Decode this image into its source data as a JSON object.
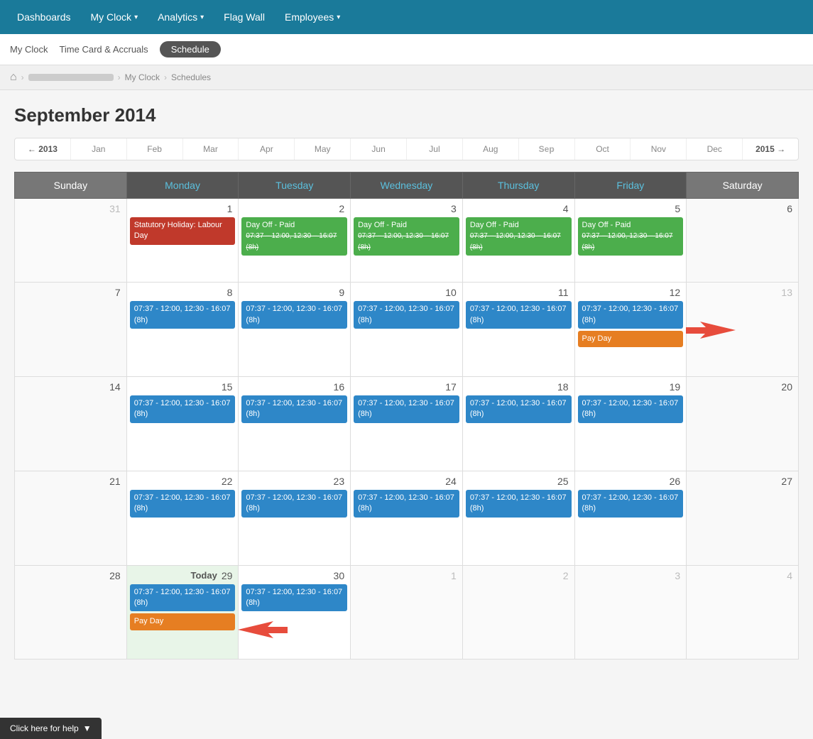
{
  "topNav": {
    "items": [
      {
        "label": "Dashboards",
        "hasArrow": false
      },
      {
        "label": "My Clock",
        "hasArrow": true
      },
      {
        "label": "Analytics",
        "hasArrow": true
      },
      {
        "label": "Flag Wall",
        "hasArrow": false
      },
      {
        "label": "Employees",
        "hasArrow": true
      }
    ]
  },
  "subNav": {
    "items": [
      {
        "label": "My Clock",
        "active": false
      },
      {
        "label": "Time Card & Accruals",
        "active": false
      },
      {
        "label": "Schedule",
        "active": true,
        "pill": true
      }
    ]
  },
  "breadcrumb": {
    "home": "⌂",
    "separator": "›",
    "links": [
      "My Clock",
      "Schedules"
    ]
  },
  "monthTitle": "September 2014",
  "monthNav": {
    "items": [
      {
        "label": "← 2013",
        "type": "arrow"
      },
      {
        "label": "Jan"
      },
      {
        "label": "Feb"
      },
      {
        "label": "Mar"
      },
      {
        "label": "Apr"
      },
      {
        "label": "May"
      },
      {
        "label": "Jun"
      },
      {
        "label": "Jul"
      },
      {
        "label": "Aug"
      },
      {
        "label": "Sep",
        "active": true
      },
      {
        "label": "Oct"
      },
      {
        "label": "Nov"
      },
      {
        "label": "Dec"
      },
      {
        "label": "2015 →",
        "type": "arrow"
      }
    ]
  },
  "calendar": {
    "headers": [
      "Sunday",
      "Monday",
      "Tuesday",
      "Wednesday",
      "Thursday",
      "Friday",
      "Saturday"
    ],
    "rows": [
      {
        "cells": [
          {
            "day": "31",
            "type": "other-month"
          },
          {
            "day": "1",
            "events": [
              {
                "text": "Statutory Holiday: Labour Day",
                "type": "red"
              }
            ]
          },
          {
            "day": "2",
            "events": [
              {
                "text": "Day Off - Paid",
                "time": "07:37 – 12:00, 12:30 – 16:07 (8h)",
                "type": "green"
              }
            ]
          },
          {
            "day": "3",
            "events": [
              {
                "text": "Day Off - Paid",
                "time": "07:37 – 12:00, 12:30 – 16:07 (8h)",
                "type": "green"
              }
            ]
          },
          {
            "day": "4",
            "events": [
              {
                "text": "Day Off - Paid",
                "time": "07:37 – 12:00, 12:30 – 16:07 (8h)",
                "type": "green"
              }
            ]
          },
          {
            "day": "5",
            "events": [
              {
                "text": "Day Off - Paid",
                "time": "07:37 – 12:00, 12:30 – 16:07 (8h)",
                "type": "green"
              }
            ]
          },
          {
            "day": "6",
            "type": "saturday"
          }
        ]
      },
      {
        "cells": [
          {
            "day": "7"
          },
          {
            "day": "8",
            "events": [
              {
                "text": "07:37 - 12:00, 12:30 - 16:07 (8h)",
                "type": "blue"
              }
            ]
          },
          {
            "day": "9",
            "events": [
              {
                "text": "07:37 - 12:00, 12:30 - 16:07 (8h)",
                "type": "blue"
              }
            ]
          },
          {
            "day": "10",
            "events": [
              {
                "text": "07:37 - 12:00, 12:30 - 16:07 (8h)",
                "type": "blue"
              }
            ]
          },
          {
            "day": "11",
            "events": [
              {
                "text": "07:37 - 12:00, 12:30 - 16:07 (8h)",
                "type": "blue"
              }
            ]
          },
          {
            "day": "12",
            "events": [
              {
                "text": "07:37 - 12:00, 12:30 - 16:07 (8h)",
                "type": "blue"
              },
              {
                "text": "Pay Day",
                "type": "orange"
              }
            ],
            "hasArrow": true
          },
          {
            "day": "13",
            "type": "saturday other-month"
          }
        ]
      },
      {
        "cells": [
          {
            "day": "14"
          },
          {
            "day": "15",
            "events": [
              {
                "text": "07:37 - 12:00, 12:30 - 16:07 (8h)",
                "type": "blue"
              }
            ]
          },
          {
            "day": "16",
            "events": [
              {
                "text": "07:37 - 12:00, 12:30 - 16:07 (8h)",
                "type": "blue"
              }
            ]
          },
          {
            "day": "17",
            "events": [
              {
                "text": "07:37 - 12:00, 12:30 - 16:07 (8h)",
                "type": "blue"
              }
            ]
          },
          {
            "day": "18",
            "events": [
              {
                "text": "07:37 - 12:00, 12:30 - 16:07 (8h)",
                "type": "blue"
              }
            ]
          },
          {
            "day": "19",
            "events": [
              {
                "text": "07:37 - 12:00, 12:30 - 16:07 (8h)",
                "type": "blue"
              }
            ]
          },
          {
            "day": "20",
            "type": "saturday"
          }
        ]
      },
      {
        "cells": [
          {
            "day": "21"
          },
          {
            "day": "22",
            "events": [
              {
                "text": "07:37 - 12:00, 12:30 - 16:07 (8h)",
                "type": "blue"
              }
            ]
          },
          {
            "day": "23",
            "events": [
              {
                "text": "07:37 - 12:00, 12:30 - 16:07 (8h)",
                "type": "blue"
              }
            ]
          },
          {
            "day": "24",
            "events": [
              {
                "text": "07:37 - 12:00, 12:30 - 16:07 (8h)",
                "type": "blue"
              }
            ]
          },
          {
            "day": "25",
            "events": [
              {
                "text": "07:37 - 12:00, 12:30 - 16:07 (8h)",
                "type": "blue"
              }
            ]
          },
          {
            "day": "26",
            "events": [
              {
                "text": "07:37 - 12:00, 12:30 - 16:07 (8h)",
                "type": "blue"
              }
            ]
          },
          {
            "day": "27",
            "type": "saturday"
          }
        ]
      },
      {
        "cells": [
          {
            "day": "28"
          },
          {
            "day": "29",
            "isToday": true,
            "events": [
              {
                "text": "07:37 - 12:00, 12:30 - 16:07 (8h)",
                "type": "blue"
              },
              {
                "text": "Pay Day",
                "type": "orange"
              }
            ]
          },
          {
            "day": "30",
            "events": [
              {
                "text": "07:37 - 12:00, 12:30 - 16:07 (8h)",
                "type": "blue"
              }
            ]
          },
          {
            "day": "1",
            "type": "other-month"
          },
          {
            "day": "2",
            "type": "other-month"
          },
          {
            "day": "3",
            "type": "other-month"
          },
          {
            "day": "4",
            "type": "other-month saturday"
          }
        ]
      }
    ]
  },
  "help": {
    "label": "Click here for help",
    "arrow": "▼"
  },
  "colors": {
    "navBg": "#1a7a9a",
    "blue": "#2e87c8",
    "green": "#4cae4c",
    "red": "#c0392b",
    "orange": "#e67e22"
  }
}
